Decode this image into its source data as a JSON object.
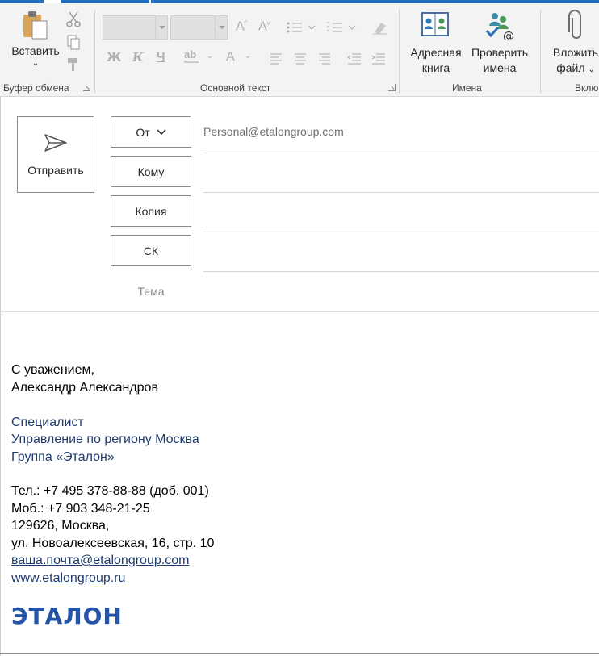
{
  "ribbon": {
    "clipboard": {
      "paste_label": "Вставить",
      "group_label": "Буфер обмена"
    },
    "basic_text": {
      "group_label": "Основной текст"
    },
    "names": {
      "address_book_label": "Адресная книга",
      "address_book_line1": "Адресная",
      "address_book_line2": "книга",
      "check_names_line1": "Проверить",
      "check_names_line2": "имена",
      "group_label": "Имена"
    },
    "include": {
      "attach_line1": "Вложить",
      "attach_line2": "файл",
      "group_label": "Вклю"
    }
  },
  "header": {
    "send_label": "Отправить",
    "from_label": "От",
    "from_value": "Personal@etalongroup.com",
    "to_label": "Кому",
    "cc_label": "Копия",
    "bcc_label": "СК",
    "subject_label": "Тема"
  },
  "signature": {
    "regards": "С уважением,",
    "name": "Александр Александров",
    "position": "Специалист",
    "department": "Управление по региону Москва",
    "company": "Группа «Эталон»",
    "phone": "Тел.: +7 495 378-88-88 (доб. 001)",
    "mobile": "Моб.: +7 903 348-21-25",
    "postal": "129626, Москва,",
    "street": "ул. Новоалексеевская, 16, стр. 10",
    "email": "ваша.почта@etalongroup.com",
    "website": "www.etalongroup.ru",
    "logo_text": "ЭТАЛОН"
  },
  "colors": {
    "accent": "#1e6fc1",
    "signature_blue": "#1f3a6e",
    "logo_blue": "#2553a6"
  }
}
